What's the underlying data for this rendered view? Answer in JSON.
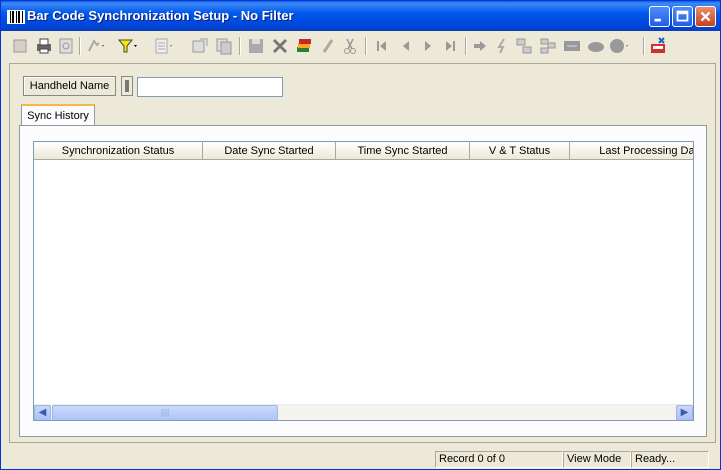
{
  "window": {
    "title": "Bar Code Synchronization Setup - No Filter"
  },
  "toolbar": {
    "icons": [
      "new-icon",
      "print-icon",
      "preview-icon",
      "run-icon",
      "filter-icon",
      "list-icon",
      "export-icon",
      "copy-icon",
      "save-icon",
      "delete-icon",
      "edit-icon",
      "undo-icon",
      "cut-icon",
      "first-icon",
      "prev-icon",
      "next-icon",
      "last-icon",
      "goto-icon",
      "process-icon",
      "tree-icon",
      "tree2-icon",
      "grid-icon",
      "cloud-icon",
      "globe-icon",
      "exit-icon"
    ]
  },
  "form": {
    "handheld_label": "Handheld Name",
    "handheld_value": ""
  },
  "tabs": [
    {
      "label": "Sync History"
    }
  ],
  "grid": {
    "columns": [
      "Synchronization Status",
      "Date Sync Started",
      "Time Sync Started",
      "V & T Status",
      "Last Processing Date"
    ],
    "rows": []
  },
  "scrollbar": {
    "left_arrow": "◀",
    "right_arrow": "▶",
    "thumb_grip": "||||"
  },
  "status": {
    "record": "Record 0 of 0",
    "mode": "View Mode",
    "state": "Ready..."
  }
}
